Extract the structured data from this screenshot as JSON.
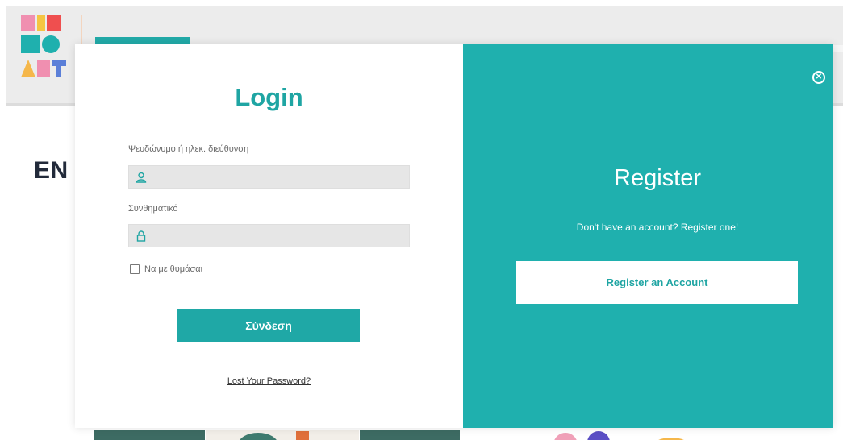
{
  "background": {
    "heading": "EN",
    "logo": {
      "lines": [
        "BID",
        "TO",
        "ART"
      ]
    }
  },
  "login": {
    "title": "Login",
    "username_label": "Ψευδώνυμο ή ηλεκ. διεύθυνση",
    "username_value": "",
    "password_label": "Συνθηματικό",
    "password_value": "",
    "remember_label": "Να με θυμάσαι",
    "submit_label": "Σύνδεση",
    "lost_password": "Lost Your Password?"
  },
  "register": {
    "title": "Register",
    "subtitle": "Don't have an account? Register one!",
    "button_label": "Register an Account"
  },
  "icons": {
    "close": "close-icon",
    "user": "user-icon",
    "lock": "lock-icon"
  },
  "colors": {
    "accent": "#1fb0ae",
    "field_bg": "#e6e6e6"
  }
}
